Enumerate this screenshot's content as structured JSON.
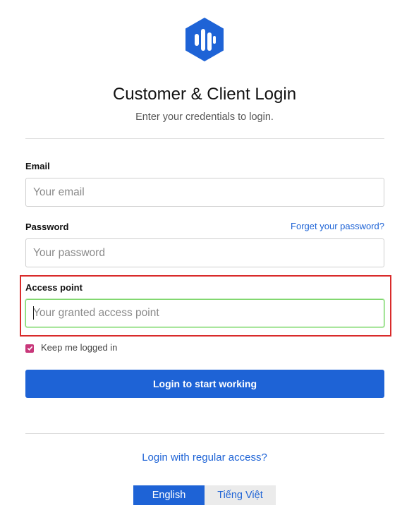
{
  "brand": {
    "logo_icon": "brand-hexagon-bars-icon",
    "accent_color": "#1e63d6"
  },
  "header": {
    "title": "Customer & Client Login",
    "subtitle": "Enter your credentials to login."
  },
  "form": {
    "email": {
      "label": "Email",
      "placeholder": "Your email",
      "value": ""
    },
    "password": {
      "label": "Password",
      "placeholder": "Your password",
      "value": "",
      "forgot_link": "Forget your password?"
    },
    "access_point": {
      "label": "Access point",
      "placeholder": "Your granted access point",
      "value": "",
      "focused": true,
      "highlight_color": "#d92b2b"
    },
    "remember": {
      "label": "Keep me logged in",
      "checked": true,
      "checkbox_color": "#c8377a"
    },
    "submit_label": "Login to start working"
  },
  "footer": {
    "alt_login_link": "Login with regular access?",
    "languages": [
      {
        "label": "English",
        "active": true
      },
      {
        "label": "Tiếng Việt",
        "active": false
      }
    ]
  }
}
